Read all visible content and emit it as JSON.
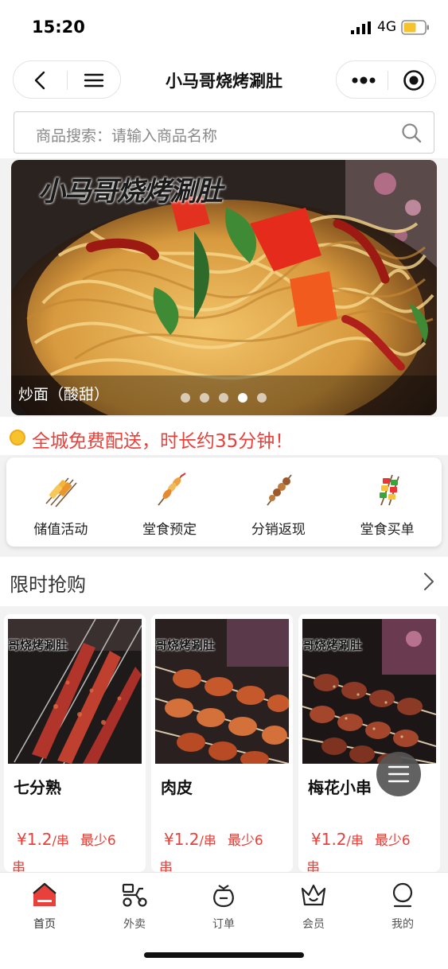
{
  "status_bar": {
    "time": "15:20",
    "network": "4G"
  },
  "nav": {
    "title": "小马哥烧烤涮肚"
  },
  "search": {
    "placeholder": "商品搜索：请输入商品名称"
  },
  "banner": {
    "brand": "小马哥烧烤涮肚",
    "caption": "炒面（酸甜）",
    "slide_count": 5,
    "active_slide": 4
  },
  "notice": {
    "text": "全城免费配送，时长约35分钟！"
  },
  "quick_menu": [
    {
      "label": "储值活动",
      "icon": "skewer-icon"
    },
    {
      "label": "堂食预定",
      "icon": "skewer-icon"
    },
    {
      "label": "分销返现",
      "icon": "skewer-icon"
    },
    {
      "label": "堂食买单",
      "icon": "skewer-icon"
    }
  ],
  "flash_sale": {
    "title": "限时抢购",
    "brand_watermark": "哥烧烤涮肚",
    "products": [
      {
        "name": "七分熟",
        "price": "¥1.2",
        "unit": "/串",
        "min": "最少6",
        "min_unit": "串"
      },
      {
        "name": "肉皮",
        "price": "¥1.2",
        "unit": "/串",
        "min": "最少6",
        "min_unit": "串"
      },
      {
        "name": "梅花小串",
        "price": "¥1.2",
        "unit": "/串",
        "min": "最少6",
        "min_unit": "串"
      }
    ]
  },
  "tabbar": [
    {
      "label": "首页",
      "icon": "home-icon",
      "active": true
    },
    {
      "label": "外卖",
      "icon": "scooter-icon",
      "active": false
    },
    {
      "label": "订单",
      "icon": "bag-icon",
      "active": false
    },
    {
      "label": "会员",
      "icon": "crown-icon",
      "active": false
    },
    {
      "label": "我的",
      "icon": "user-icon",
      "active": false
    }
  ],
  "colors": {
    "accent": "#e8403a",
    "home_active": "#e8403a",
    "coin": "#f5c32c"
  }
}
